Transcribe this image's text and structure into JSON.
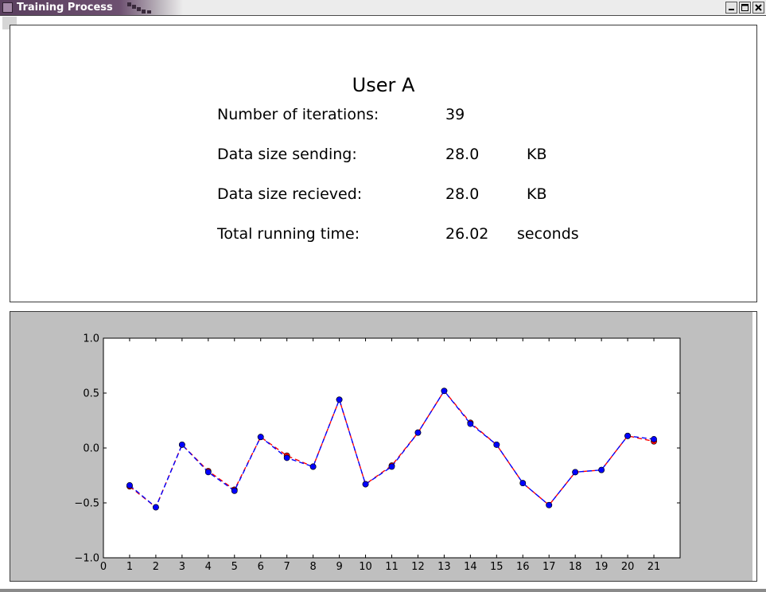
{
  "window": {
    "title": "Training Process",
    "buttons": {
      "minimize": "minimize-icon",
      "maximize": "maximize-icon",
      "close": "close-icon"
    }
  },
  "info": {
    "user": "User A",
    "rows": [
      {
        "label": "Number of iterations:",
        "value": "39",
        "unit": ""
      },
      {
        "label": "Data size sending:",
        "value": "28.0",
        "unit": "KB"
      },
      {
        "label": "Data size recieved:",
        "value": "28.0",
        "unit": "KB"
      },
      {
        "label": "Total running time:",
        "value": "26.02",
        "unit": "seconds"
      }
    ]
  },
  "chart_data": {
    "type": "line",
    "title": "",
    "xlabel": "",
    "ylabel": "",
    "xlim": [
      0,
      22
    ],
    "ylim": [
      -1.0,
      1.0
    ],
    "xticks": [
      "0",
      "1",
      "2",
      "3",
      "4",
      "5",
      "6",
      "7",
      "8",
      "9",
      "10",
      "11",
      "12",
      "13",
      "14",
      "15",
      "16",
      "17",
      "18",
      "19",
      "20",
      "21"
    ],
    "yticks": [
      "1.0",
      "0.5",
      "0.0",
      "−0.5",
      "−1.0"
    ],
    "ytick_values": [
      1.0,
      0.5,
      0.0,
      -0.5,
      -1.0
    ],
    "grid": false,
    "x": [
      1,
      2,
      3,
      4,
      5,
      6,
      7,
      8,
      9,
      10,
      11,
      12,
      13,
      14,
      15,
      16,
      17,
      18,
      19,
      20,
      21
    ],
    "series": [
      {
        "color": "#ff0000",
        "style": "dashed-with-dots",
        "values": [
          -0.35,
          -0.54,
          0.03,
          -0.21,
          -0.38,
          0.1,
          -0.07,
          -0.17,
          0.44,
          -0.33,
          -0.16,
          0.14,
          0.52,
          0.23,
          0.03,
          -0.32,
          -0.52,
          -0.22,
          -0.2,
          0.11,
          0.06
        ]
      },
      {
        "color": "#0000ff",
        "style": "dashed-with-dots",
        "values": [
          -0.34,
          -0.54,
          0.03,
          -0.22,
          -0.39,
          0.1,
          -0.09,
          -0.17,
          0.44,
          -0.33,
          -0.17,
          0.14,
          0.52,
          0.22,
          0.03,
          -0.32,
          -0.52,
          -0.22,
          -0.2,
          0.11,
          0.08
        ]
      }
    ]
  }
}
